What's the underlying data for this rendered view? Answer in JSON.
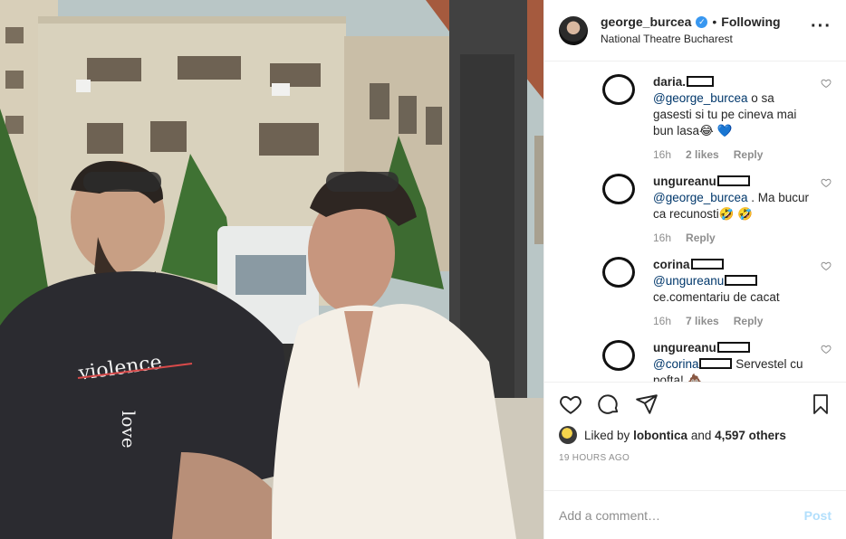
{
  "photo": {
    "alt_icon": "post-photo",
    "sweater_text_1": "violence",
    "sweater_text_2": "love"
  },
  "header": {
    "username": "george_burcea",
    "separator": "•",
    "follow_status": "Following",
    "location": "National Theatre Bucharest",
    "more_icon": "more-options-icon"
  },
  "comments": [
    {
      "user": "daria.",
      "text": " o sa gasesti si tu pe cineva mai bun lasa",
      "mention": "@george_burcea",
      "emoji": "😂 💙",
      "time": "16h",
      "likes": "2 likes",
      "reply": "Reply"
    },
    {
      "user": "ungureanu",
      "text": " . Ma bucur ca recunosti",
      "mention": "@george_burcea",
      "emoji": "🤣 🤣",
      "time": "16h",
      "likes": "",
      "reply": "Reply"
    },
    {
      "user": "corina",
      "text": "ce.comentariu de cacat",
      "mention": "@ungureanu",
      "emoji": "",
      "time": "16h",
      "likes": "7 likes",
      "reply": "Reply"
    },
    {
      "user": "ungureanu",
      "text": " Servestel cu pofta!",
      "mention": "@corina",
      "emoji": "💩",
      "time": "",
      "likes": "",
      "reply": ""
    }
  ],
  "actions": {
    "liked_prefix": "Liked by ",
    "liked_user": "lobontica",
    "liked_and": " and ",
    "liked_count": "4,597 others",
    "timeago": "19 HOURS AGO"
  },
  "add_comment": {
    "placeholder": "Add a comment…",
    "post_label": "Post"
  },
  "colors": {
    "link": "#00376b",
    "verified": "#3897f0",
    "muted": "#8e8e8e",
    "post_disabled": "#b2dffc"
  }
}
